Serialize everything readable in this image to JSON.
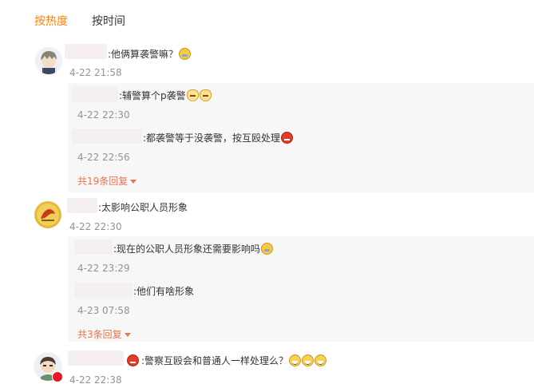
{
  "tabs": {
    "hot": "按热度",
    "time": "按时间"
  },
  "comments": [
    {
      "text": ":他俩算袭警嘛？",
      "time": "4-22 21:58",
      "replies": [
        {
          "text": ":辅警算个p袭警",
          "time": "4-22 22:30"
        },
        {
          "text": ":都袭警等于没袭警，按互殴处理",
          "time": "4-22 22:56"
        }
      ],
      "more": "共19条回复"
    },
    {
      "text": ":太影响公职人员形象",
      "time": "4-22 22:30",
      "replies": [
        {
          "text": ":现在的公职人员形象还需要影响吗",
          "time": "4-22 23:29"
        },
        {
          "text": ":他们有啥形象",
          "time": "4-23 07:58"
        }
      ],
      "more": "共3条回复"
    },
    {
      "text": ":警察互殴会和普通人一样处理么？",
      "time": "4-22 22:38"
    }
  ]
}
